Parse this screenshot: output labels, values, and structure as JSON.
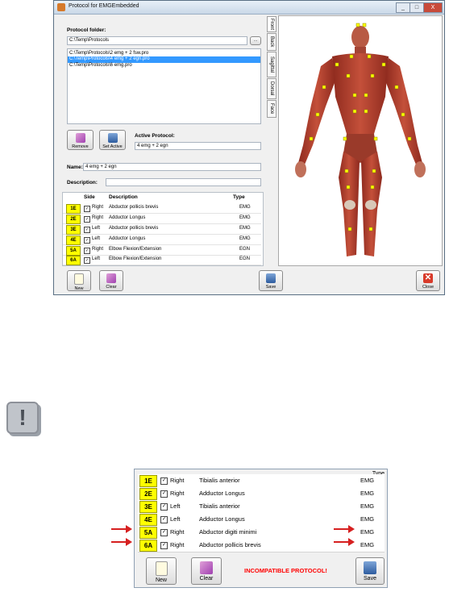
{
  "window": {
    "title": "Protocol for EMGEmbedded",
    "buttons": [
      "_",
      "□",
      "X"
    ]
  },
  "protocol_folder": {
    "label": "Protocol folder:",
    "path_value": "C:\\Temp\\Protocols",
    "browse_label": "...",
    "files": [
      "C:\\Temp\\Protocols\\2 emg + 2 fsw.pro",
      "C:\\Temp\\Protocols\\4 emg + 2 egn.pro",
      "C:\\Temp\\Protocols\\6 emg.pro"
    ],
    "selected_index": 1
  },
  "actions": {
    "remove_label": "Remove",
    "set_active_label": "Set Active"
  },
  "active_protocol": {
    "label": "Active Protocol:",
    "value": "4 emg + 2 egn"
  },
  "name": {
    "label": "Name:",
    "value": "4 emg + 2 egn"
  },
  "description": {
    "label": "Description:",
    "value": ""
  },
  "grid": {
    "columns": [
      "Side",
      "Description",
      "Type"
    ],
    "rows": [
      {
        "label": "1E",
        "side": "Right",
        "description": "Abductor pollicis brevis",
        "type": "EMG"
      },
      {
        "label": "2E",
        "side": "Right",
        "description": "Adductor Longus",
        "type": "EMG"
      },
      {
        "label": "3E",
        "side": "Left",
        "description": "Abductor pollicis brevis",
        "type": "EMG"
      },
      {
        "label": "4E",
        "side": "Left",
        "description": "Adductor Longus",
        "type": "EMG"
      },
      {
        "label": "5A",
        "side": "Right",
        "description": "Elbow Flexion/Extension",
        "type": "EGN"
      },
      {
        "label": "6A",
        "side": "Left",
        "description": "Elbow Flexion/Extension",
        "type": "EGN"
      }
    ]
  },
  "view_tabs": [
    "Front",
    "Back",
    "Sagittal",
    "Dorsal",
    "Face"
  ],
  "bottom": {
    "new_label": "New",
    "clear_label": "Clear",
    "save_label": "Save",
    "close_label": "Close"
  },
  "warning_icon": "!",
  "incompatible": {
    "type_header": "Type",
    "rows": [
      {
        "label": "1E",
        "side": "Right",
        "description": "Tibialis anterior",
        "type": "EMG"
      },
      {
        "label": "2E",
        "side": "Right",
        "description": "Adductor Longus",
        "type": "EMG"
      },
      {
        "label": "3E",
        "side": "Left",
        "description": "Tibialis anterior",
        "type": "EMG"
      },
      {
        "label": "4E",
        "side": "Left",
        "description": "Adductor Longus",
        "type": "EMG"
      },
      {
        "label": "5A",
        "side": "Right",
        "description": "Abductor digiti minimi",
        "type": "EMG"
      },
      {
        "label": "6A",
        "side": "Right",
        "description": "Abductor pollicis brevis",
        "type": "EMG"
      }
    ],
    "message": "INCOMPATIBLE PROTOCOL!",
    "new_label": "New",
    "clear_label": "Clear",
    "save_label": "Save"
  },
  "colors": {
    "channel_label_bg": "#ffff00",
    "selection": "#3399ff",
    "warning_text": "#ff0000",
    "arrow": "#d62020"
  }
}
